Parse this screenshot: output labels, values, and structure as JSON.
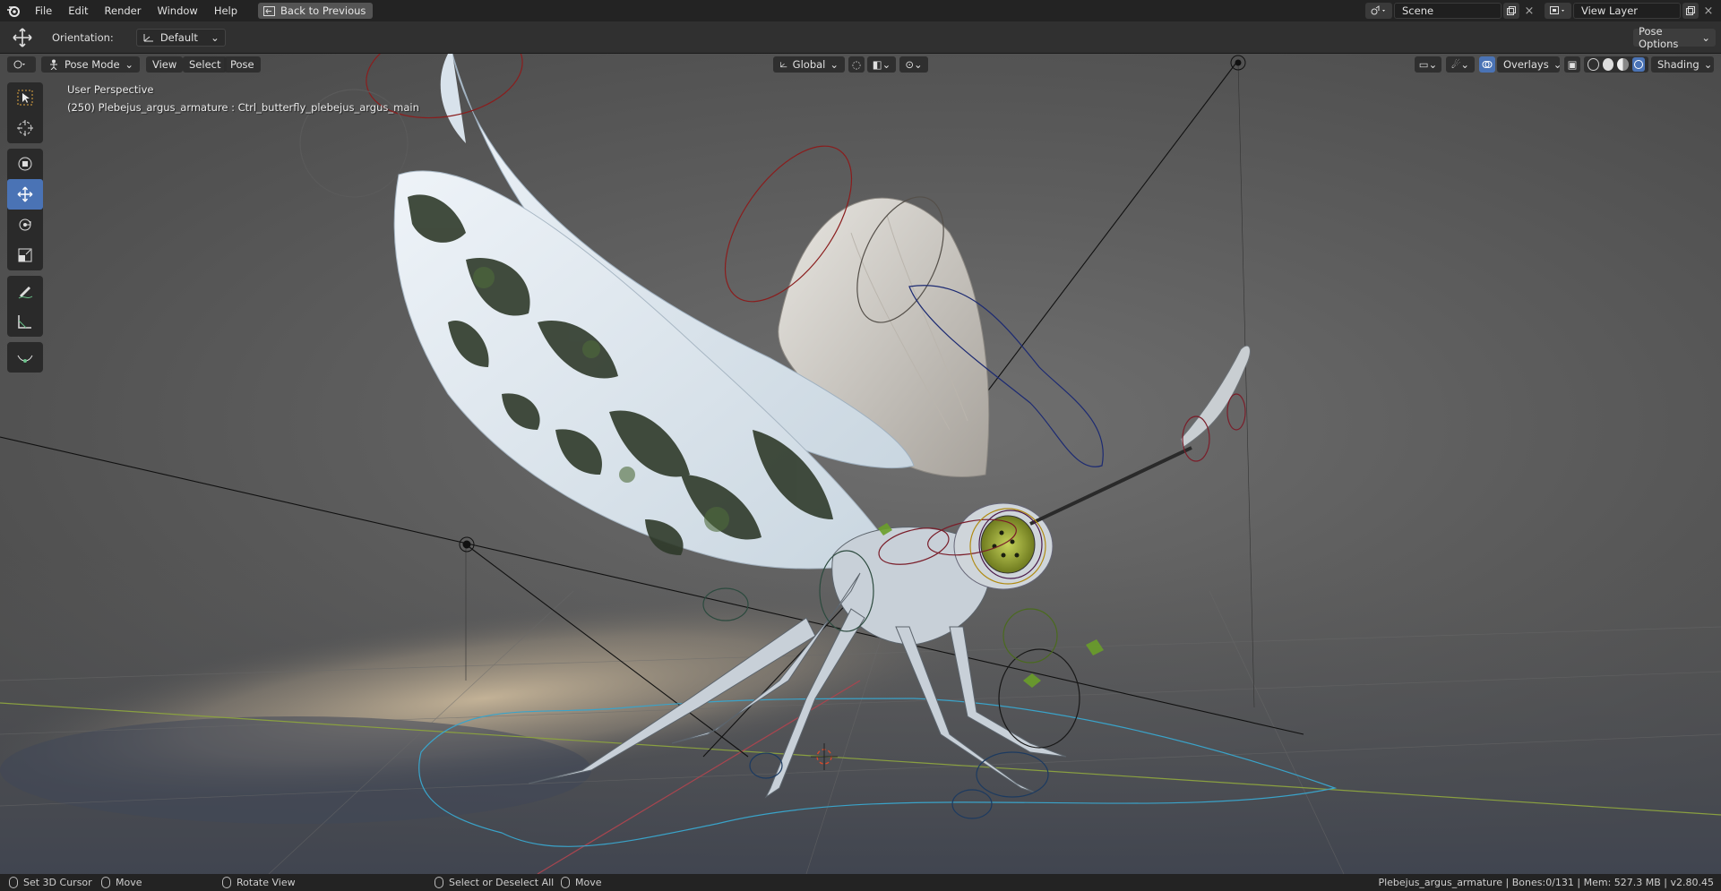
{
  "menu": {
    "items": [
      "File",
      "Edit",
      "Render",
      "Window",
      "Help"
    ],
    "back_button": "Back to Previous"
  },
  "scene": {
    "value": "Scene"
  },
  "view_layer": {
    "value": "View Layer"
  },
  "tool_header": {
    "orientation_label": "Orientation:",
    "orientation_value": "Default",
    "pose_options": "Pose Options"
  },
  "viewport_header": {
    "mode": "Pose Mode",
    "menus": [
      "View",
      "Select",
      "Pose"
    ],
    "transform_orientation": "Global",
    "overlays": "Overlays",
    "shading": "Shading"
  },
  "viewport": {
    "perspective": "User Perspective",
    "object_info": "(250) Plebejus_argus_armature : Ctrl_butterfly_plebejus_argus_main"
  },
  "statusbar": {
    "set_cursor": "Set 3D Cursor",
    "move1": "Move",
    "rotate": "Rotate View",
    "select": "Select or Deselect All",
    "move2": "Move",
    "stats": "Plebejus_argus_armature | Bones:0/131 | Mem: 527.3 MB | v2.80.45"
  },
  "colors": {
    "active_tool": "#4a73b5",
    "x_axis": "#a8454f",
    "y_axis": "#8aa040"
  }
}
